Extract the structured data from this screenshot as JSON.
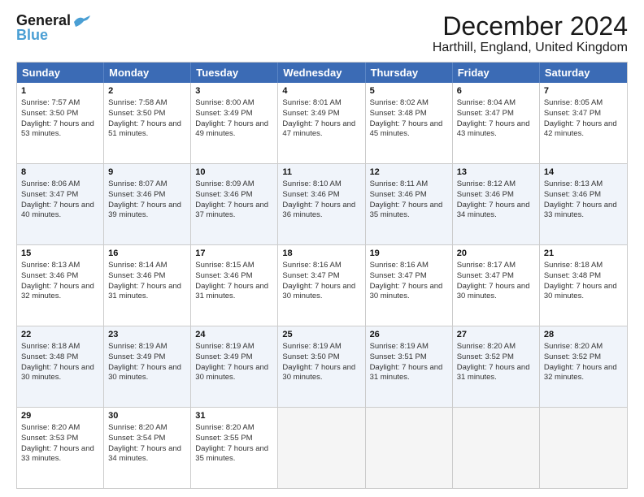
{
  "header": {
    "logo_line1": "General",
    "logo_line2": "Blue",
    "title": "December 2024",
    "subtitle": "Harthill, England, United Kingdom"
  },
  "weekdays": [
    "Sunday",
    "Monday",
    "Tuesday",
    "Wednesday",
    "Thursday",
    "Friday",
    "Saturday"
  ],
  "rows": [
    [
      {
        "day": "1",
        "sunrise": "Sunrise: 7:57 AM",
        "sunset": "Sunset: 3:50 PM",
        "daylight": "Daylight: 7 hours and 53 minutes."
      },
      {
        "day": "2",
        "sunrise": "Sunrise: 7:58 AM",
        "sunset": "Sunset: 3:50 PM",
        "daylight": "Daylight: 7 hours and 51 minutes."
      },
      {
        "day": "3",
        "sunrise": "Sunrise: 8:00 AM",
        "sunset": "Sunset: 3:49 PM",
        "daylight": "Daylight: 7 hours and 49 minutes."
      },
      {
        "day": "4",
        "sunrise": "Sunrise: 8:01 AM",
        "sunset": "Sunset: 3:49 PM",
        "daylight": "Daylight: 7 hours and 47 minutes."
      },
      {
        "day": "5",
        "sunrise": "Sunrise: 8:02 AM",
        "sunset": "Sunset: 3:48 PM",
        "daylight": "Daylight: 7 hours and 45 minutes."
      },
      {
        "day": "6",
        "sunrise": "Sunrise: 8:04 AM",
        "sunset": "Sunset: 3:47 PM",
        "daylight": "Daylight: 7 hours and 43 minutes."
      },
      {
        "day": "7",
        "sunrise": "Sunrise: 8:05 AM",
        "sunset": "Sunset: 3:47 PM",
        "daylight": "Daylight: 7 hours and 42 minutes."
      }
    ],
    [
      {
        "day": "8",
        "sunrise": "Sunrise: 8:06 AM",
        "sunset": "Sunset: 3:47 PM",
        "daylight": "Daylight: 7 hours and 40 minutes."
      },
      {
        "day": "9",
        "sunrise": "Sunrise: 8:07 AM",
        "sunset": "Sunset: 3:46 PM",
        "daylight": "Daylight: 7 hours and 39 minutes."
      },
      {
        "day": "10",
        "sunrise": "Sunrise: 8:09 AM",
        "sunset": "Sunset: 3:46 PM",
        "daylight": "Daylight: 7 hours and 37 minutes."
      },
      {
        "day": "11",
        "sunrise": "Sunrise: 8:10 AM",
        "sunset": "Sunset: 3:46 PM",
        "daylight": "Daylight: 7 hours and 36 minutes."
      },
      {
        "day": "12",
        "sunrise": "Sunrise: 8:11 AM",
        "sunset": "Sunset: 3:46 PM",
        "daylight": "Daylight: 7 hours and 35 minutes."
      },
      {
        "day": "13",
        "sunrise": "Sunrise: 8:12 AM",
        "sunset": "Sunset: 3:46 PM",
        "daylight": "Daylight: 7 hours and 34 minutes."
      },
      {
        "day": "14",
        "sunrise": "Sunrise: 8:13 AM",
        "sunset": "Sunset: 3:46 PM",
        "daylight": "Daylight: 7 hours and 33 minutes."
      }
    ],
    [
      {
        "day": "15",
        "sunrise": "Sunrise: 8:13 AM",
        "sunset": "Sunset: 3:46 PM",
        "daylight": "Daylight: 7 hours and 32 minutes."
      },
      {
        "day": "16",
        "sunrise": "Sunrise: 8:14 AM",
        "sunset": "Sunset: 3:46 PM",
        "daylight": "Daylight: 7 hours and 31 minutes."
      },
      {
        "day": "17",
        "sunrise": "Sunrise: 8:15 AM",
        "sunset": "Sunset: 3:46 PM",
        "daylight": "Daylight: 7 hours and 31 minutes."
      },
      {
        "day": "18",
        "sunrise": "Sunrise: 8:16 AM",
        "sunset": "Sunset: 3:47 PM",
        "daylight": "Daylight: 7 hours and 30 minutes."
      },
      {
        "day": "19",
        "sunrise": "Sunrise: 8:16 AM",
        "sunset": "Sunset: 3:47 PM",
        "daylight": "Daylight: 7 hours and 30 minutes."
      },
      {
        "day": "20",
        "sunrise": "Sunrise: 8:17 AM",
        "sunset": "Sunset: 3:47 PM",
        "daylight": "Daylight: 7 hours and 30 minutes."
      },
      {
        "day": "21",
        "sunrise": "Sunrise: 8:18 AM",
        "sunset": "Sunset: 3:48 PM",
        "daylight": "Daylight: 7 hours and 30 minutes."
      }
    ],
    [
      {
        "day": "22",
        "sunrise": "Sunrise: 8:18 AM",
        "sunset": "Sunset: 3:48 PM",
        "daylight": "Daylight: 7 hours and 30 minutes."
      },
      {
        "day": "23",
        "sunrise": "Sunrise: 8:19 AM",
        "sunset": "Sunset: 3:49 PM",
        "daylight": "Daylight: 7 hours and 30 minutes."
      },
      {
        "day": "24",
        "sunrise": "Sunrise: 8:19 AM",
        "sunset": "Sunset: 3:49 PM",
        "daylight": "Daylight: 7 hours and 30 minutes."
      },
      {
        "day": "25",
        "sunrise": "Sunrise: 8:19 AM",
        "sunset": "Sunset: 3:50 PM",
        "daylight": "Daylight: 7 hours and 30 minutes."
      },
      {
        "day": "26",
        "sunrise": "Sunrise: 8:19 AM",
        "sunset": "Sunset: 3:51 PM",
        "daylight": "Daylight: 7 hours and 31 minutes."
      },
      {
        "day": "27",
        "sunrise": "Sunrise: 8:20 AM",
        "sunset": "Sunset: 3:52 PM",
        "daylight": "Daylight: 7 hours and 31 minutes."
      },
      {
        "day": "28",
        "sunrise": "Sunrise: 8:20 AM",
        "sunset": "Sunset: 3:52 PM",
        "daylight": "Daylight: 7 hours and 32 minutes."
      }
    ],
    [
      {
        "day": "29",
        "sunrise": "Sunrise: 8:20 AM",
        "sunset": "Sunset: 3:53 PM",
        "daylight": "Daylight: 7 hours and 33 minutes."
      },
      {
        "day": "30",
        "sunrise": "Sunrise: 8:20 AM",
        "sunset": "Sunset: 3:54 PM",
        "daylight": "Daylight: 7 hours and 34 minutes."
      },
      {
        "day": "31",
        "sunrise": "Sunrise: 8:20 AM",
        "sunset": "Sunset: 3:55 PM",
        "daylight": "Daylight: 7 hours and 35 minutes."
      },
      null,
      null,
      null,
      null
    ]
  ]
}
